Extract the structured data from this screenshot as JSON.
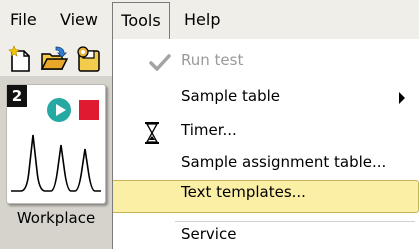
{
  "menubar": {
    "file": "File",
    "view": "View",
    "tools": "Tools",
    "help": "Help"
  },
  "toolbar": {
    "icons": [
      "new-file-icon",
      "open-folder-icon",
      "save-icon"
    ]
  },
  "left_panel": {
    "badge": "2",
    "workplace_label": "Workplace"
  },
  "tools_menu": {
    "items": [
      {
        "label": "Run test",
        "enabled": false,
        "icon": "check-icon"
      },
      {
        "label": "Sample table",
        "submenu": true
      },
      {
        "label": "Timer...",
        "icon": "hourglass-icon"
      },
      {
        "label": "Sample assignment table..."
      },
      {
        "label": "Text templates...",
        "highlighted": true
      },
      {
        "label": "Service"
      }
    ]
  },
  "colors": {
    "highlight": "#fbeea5",
    "menu_bg": "#ffffff",
    "bar_bg": "#efeee9",
    "play": "#27a9a3",
    "stop": "#e01b2f"
  }
}
